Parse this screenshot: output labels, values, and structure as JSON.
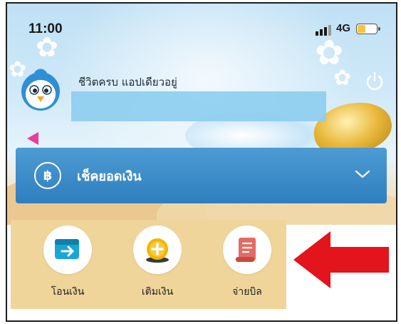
{
  "status_bar": {
    "time": "11:00",
    "network": "4G",
    "battery_color": "#f5c542"
  },
  "header": {
    "greeting": "ชีวิตครบ แอปเดียวอยู่",
    "avatar_icon": "penguin-mascot-icon",
    "power_icon": "power-icon"
  },
  "balance": {
    "label": "เช็คยอดเงิน",
    "currency_symbol": "฿",
    "bar_color": "#3a8ac7"
  },
  "quick_menu": {
    "items": [
      {
        "label": "โอนเงิน",
        "icon": "transfer-card-icon"
      },
      {
        "label": "เติมเงิน",
        "icon": "topup-coin-icon"
      },
      {
        "label": "จ่ายบิล",
        "icon": "bill-scroll-icon"
      }
    ],
    "highlight_color": "#f0d59a",
    "annotation_arrow_color": "#e3141b"
  }
}
